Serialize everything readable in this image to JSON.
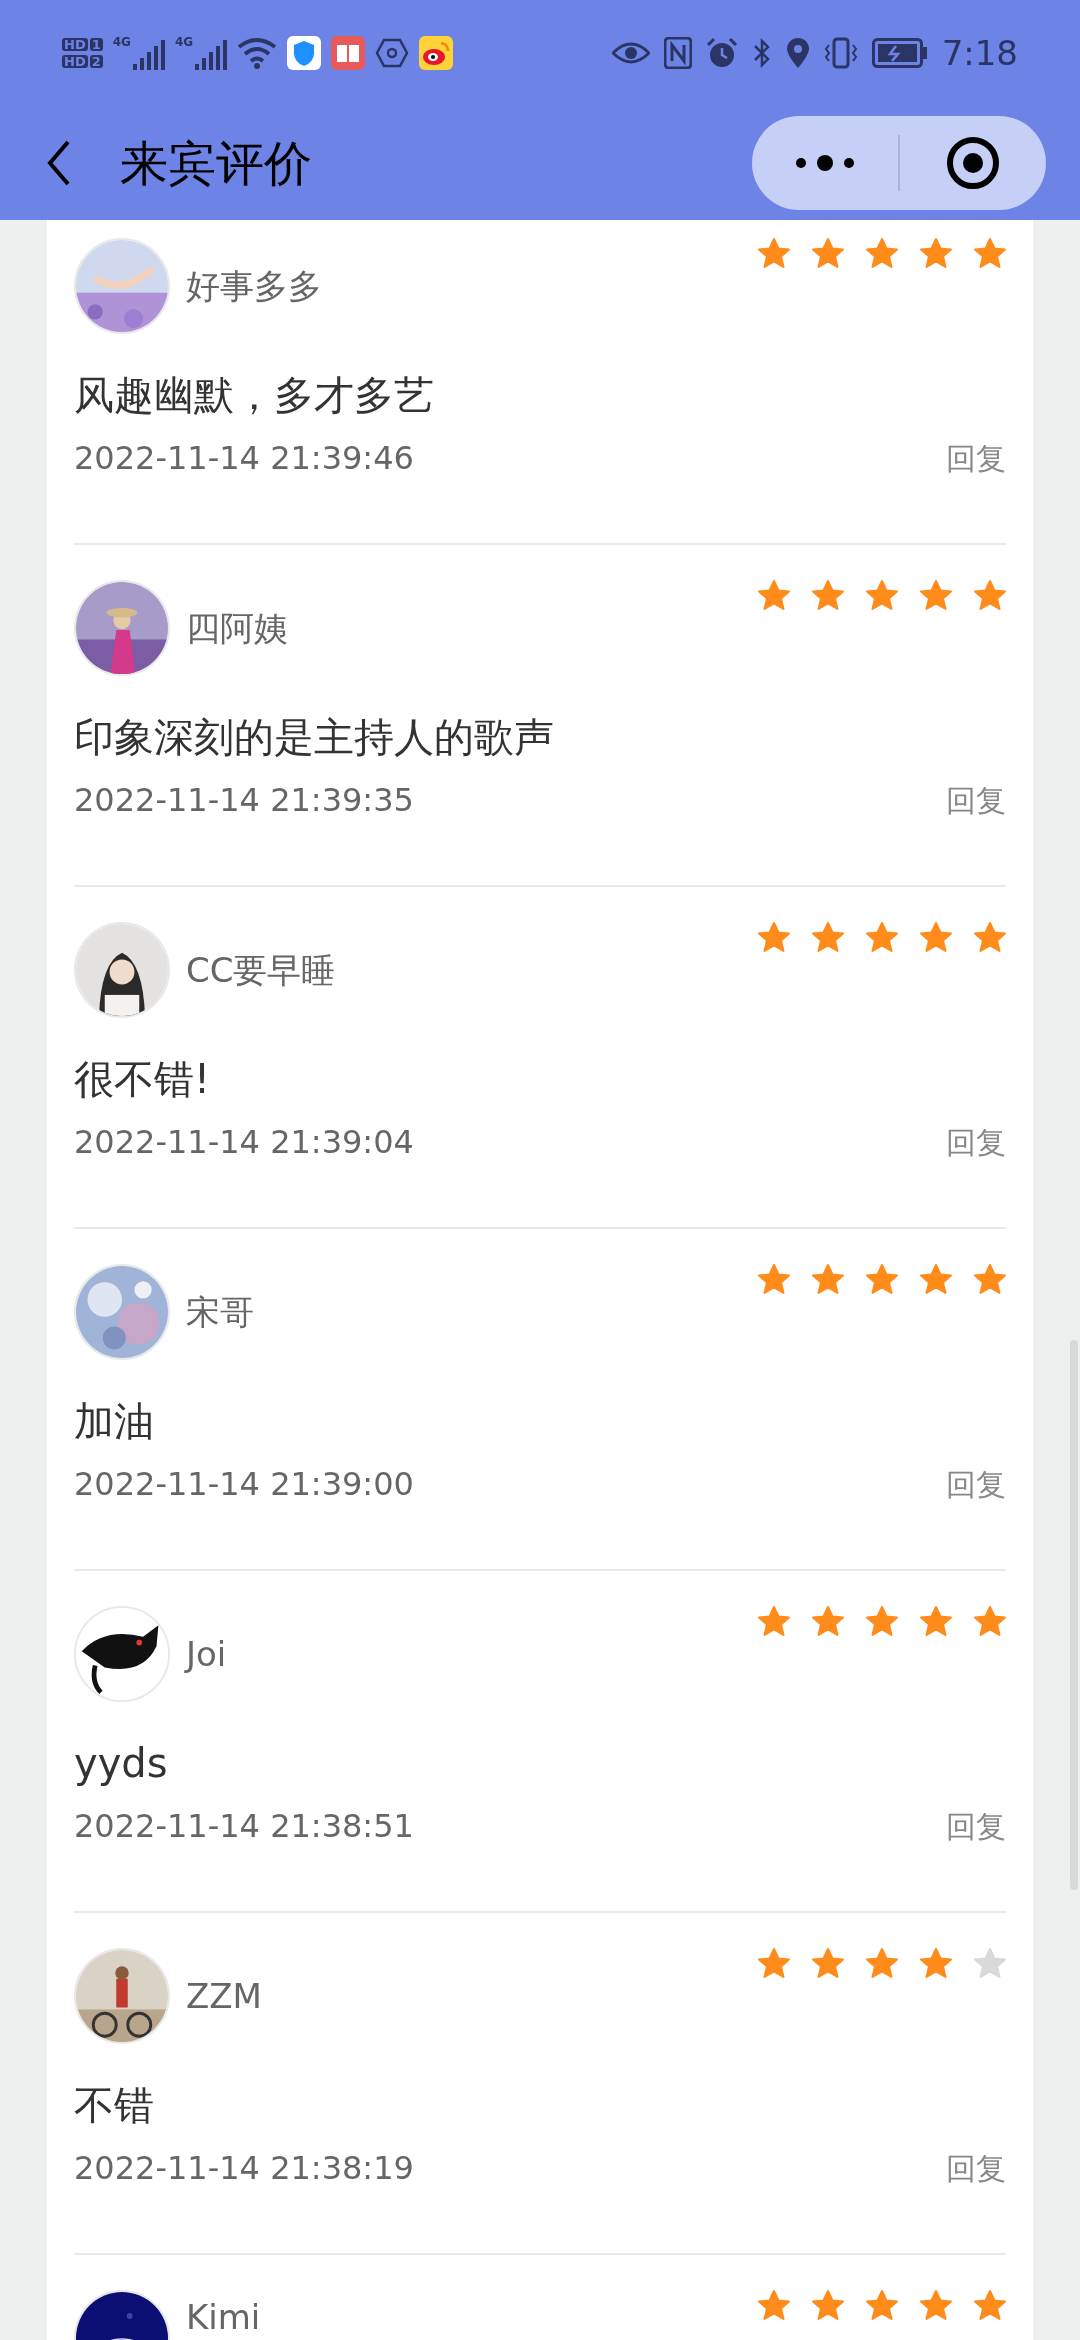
{
  "status_bar": {
    "sims": [
      {
        "badge": "HD",
        "slot": "1"
      },
      {
        "badge": "HD",
        "slot": "2"
      }
    ],
    "signals": [
      {
        "network": "4G"
      },
      {
        "network": "4G"
      }
    ],
    "time": "7:18"
  },
  "nav": {
    "title": "来宾评价"
  },
  "reviews": [
    {
      "name": "好事多多",
      "stars": 5,
      "comment": "风趣幽默，多才多艺",
      "date": "2022-11-14 21:39:46",
      "reply": "回复"
    },
    {
      "name": "四阿姨",
      "stars": 5,
      "comment": "印象深刻的是主持人的歌声",
      "date": "2022-11-14 21:39:35",
      "reply": "回复"
    },
    {
      "name": "CC要早睡",
      "stars": 5,
      "comment": "很不错!",
      "date": "2022-11-14 21:39:04",
      "reply": "回复"
    },
    {
      "name": "宋哥",
      "stars": 5,
      "comment": "加油",
      "date": "2022-11-14 21:39:00",
      "reply": "回复"
    },
    {
      "name": "Joi",
      "stars": 5,
      "comment": "yyds",
      "date": "2022-11-14 21:38:51",
      "reply": "回复"
    },
    {
      "name": "ZZM",
      "stars": 4,
      "comment": "不错",
      "date": "2022-11-14 21:38:19",
      "reply": "回复"
    },
    {
      "name": "Kimi",
      "stars": 5
    }
  ]
}
